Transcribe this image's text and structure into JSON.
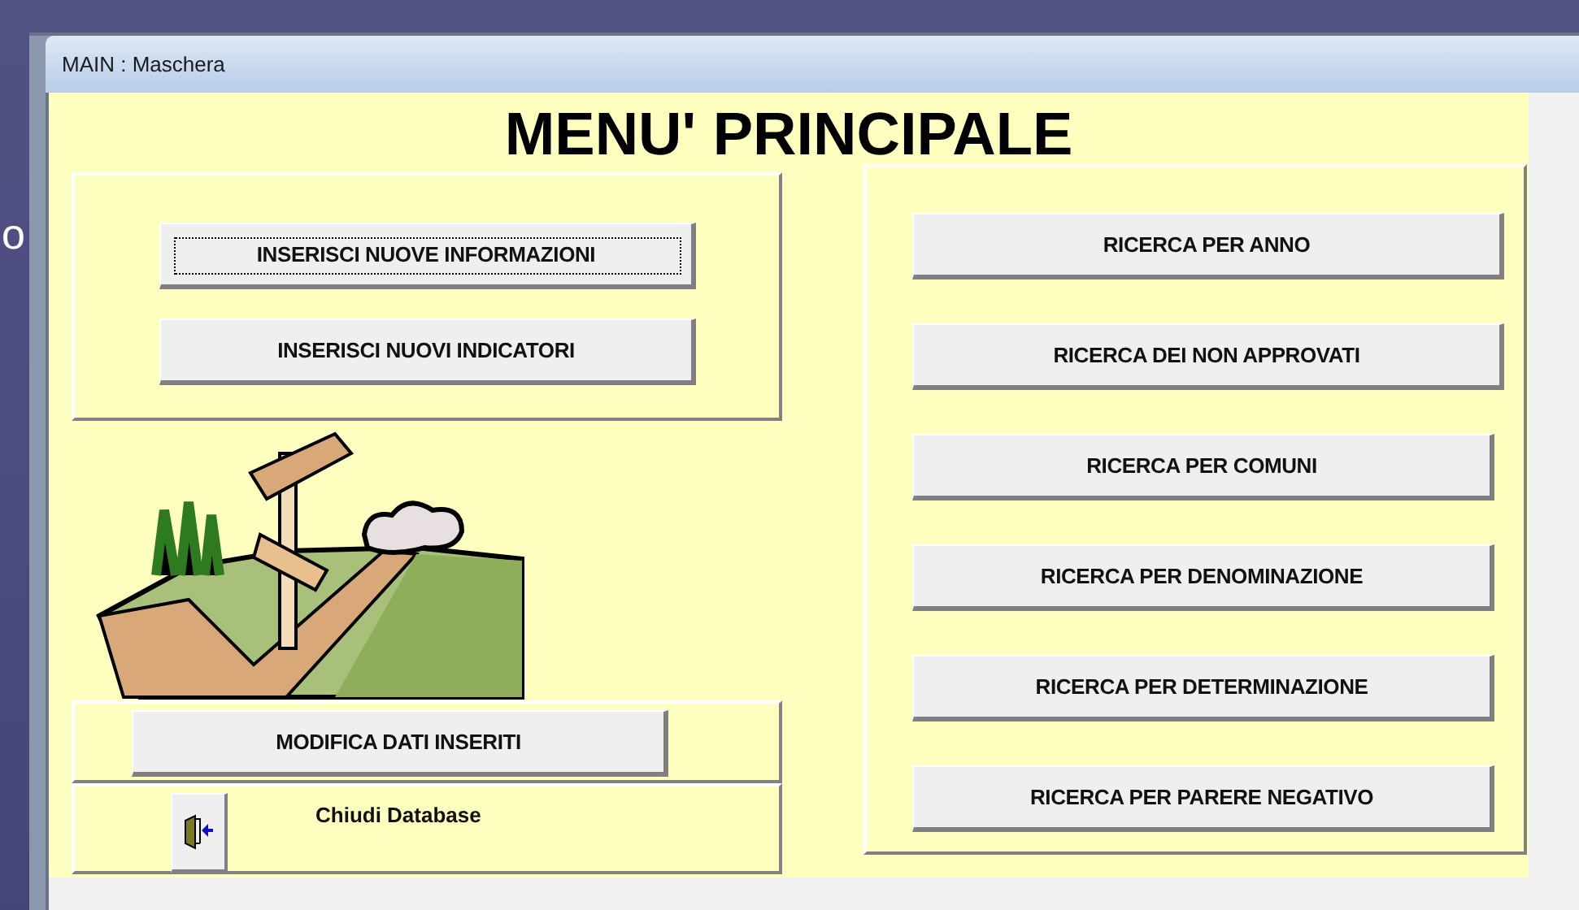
{
  "background_text": "o",
  "window": {
    "title": "MAIN : Maschera"
  },
  "form": {
    "heading": "MENU' PRINCIPALE",
    "insert_buttons": [
      {
        "label": "INSERISCI NUOVE INFORMAZIONI",
        "focused": true
      },
      {
        "label": "INSERISCI NUOVI INDICATORI",
        "focused": false
      }
    ],
    "edit_button": {
      "label": "MODIFICA DATI INSERITI"
    },
    "close_label": "Chiudi Database",
    "search_buttons": [
      {
        "label": "RICERCA PER ANNO"
      },
      {
        "label": "RICERCA DEI NON APPROVATI"
      },
      {
        "label": "RICERCA PER COMUNI"
      },
      {
        "label": "RICERCA PER DENOMINAZIONE"
      },
      {
        "label": "RICERCA PER DETERMINAZIONE"
      },
      {
        "label": "RICERCA PER PARERE NEGATIVO"
      }
    ]
  }
}
